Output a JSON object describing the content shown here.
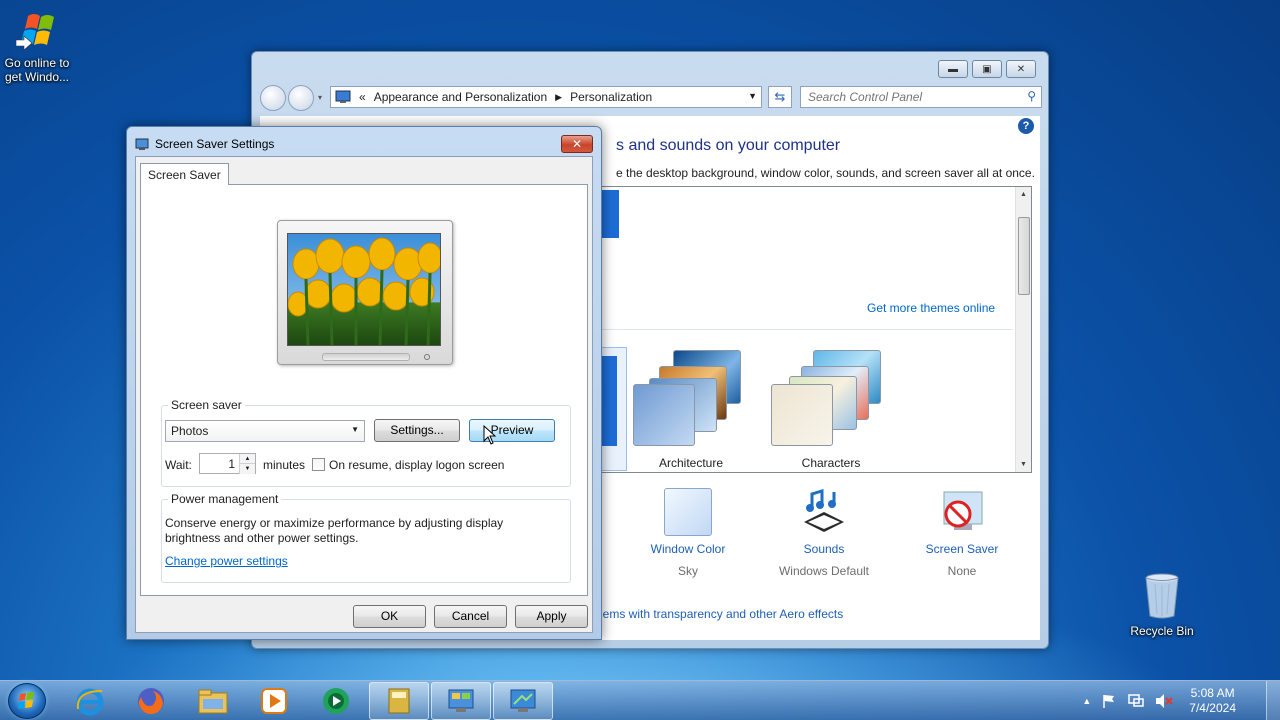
{
  "desktop": {
    "icons": [
      {
        "label": "Go online to get Windo..."
      },
      {
        "label": "Recycle Bin"
      }
    ]
  },
  "control_panel": {
    "breadcrumb_root": "«",
    "breadcrumb_1": "Appearance and Personalization",
    "breadcrumb_2": "Personalization",
    "search_placeholder": "Search Control Panel",
    "heading": "s and sounds on your computer",
    "subtitle": "e the desktop background, window color, sounds, and screen saver all at once.",
    "get_more_themes": "Get more themes online",
    "themes": [
      {
        "name": "Architecture"
      },
      {
        "name": "Characters"
      }
    ],
    "bottom_items": [
      {
        "label": "Window Color",
        "sub": "Sky"
      },
      {
        "label": "Sounds",
        "sub": "Windows Default"
      },
      {
        "label": "Screen Saver",
        "sub": "None"
      }
    ],
    "partial_bracket": "l",
    "aero_link": "lems with transparency and other Aero effects"
  },
  "screen_saver_dialog": {
    "title": "Screen Saver Settings",
    "tab": "Screen Saver",
    "screen_saver_group": "Screen saver",
    "selected_saver": "Photos",
    "settings_button": "Settings...",
    "preview_button": "Preview",
    "wait_label": "Wait:",
    "wait_value": "1",
    "minutes_label": "minutes",
    "resume_label": "On resume, display logon screen",
    "resume_checked": false,
    "power_group": "Power management",
    "power_text_1": "Conserve energy or maximize performance by adjusting display",
    "power_text_2": "brightness and other power settings.",
    "power_link": "Change power settings",
    "ok_button": "OK",
    "cancel_button": "Cancel",
    "apply_button": "Apply"
  },
  "taskbar": {
    "time": "5:08 AM",
    "date": "7/4/2024"
  }
}
